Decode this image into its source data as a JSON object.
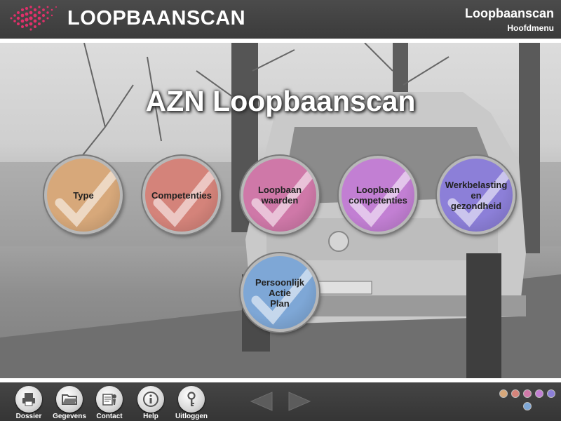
{
  "header": {
    "brand": "LOOPBAANSCAN",
    "app_title": "Loopbaanscan",
    "app_subtitle": "Hoofdmenu"
  },
  "main": {
    "heading": "AZN Loopbaanscan",
    "modules": [
      {
        "label": "Type",
        "color": "#d7a87a"
      },
      {
        "label": "Competenties",
        "color": "#d4837a"
      },
      {
        "label": "Loopbaan\nwaarden",
        "color": "#cf78a8"
      },
      {
        "label": "Loopbaan\ncompetenties",
        "color": "#c27fd3"
      },
      {
        "label": "Werkbelasting\nen\ngezondheid",
        "color": "#8c7fd8"
      },
      {
        "label": "Persoonlijk\nActie\nPlan",
        "color": "#7ea7d6"
      }
    ]
  },
  "footer": {
    "buttons": [
      {
        "label": "Dossier",
        "icon": "printer-icon"
      },
      {
        "label": "Gegevens",
        "icon": "folder-icon"
      },
      {
        "label": "Contact",
        "icon": "contact-card-icon"
      },
      {
        "label": "Help",
        "icon": "info-icon"
      },
      {
        "label": "Uitloggen",
        "icon": "key-icon"
      }
    ],
    "nav": {
      "prev": "arrow-left-icon",
      "next": "arrow-right-icon"
    },
    "progress_colors": [
      "#d7a87a",
      "#d4837a",
      "#cf78a8",
      "#c27fd3",
      "#8c7fd8",
      "#7ea7d6"
    ]
  },
  "colors": {
    "brand_accent": "#e0306a",
    "bar": "#3f3f3f"
  }
}
